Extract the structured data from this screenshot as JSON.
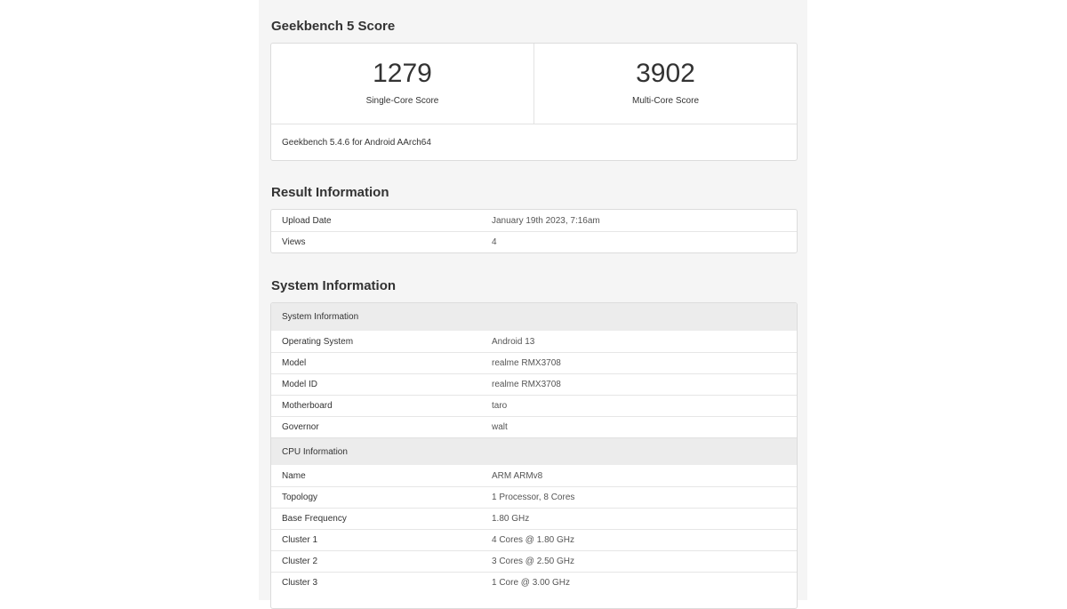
{
  "score": {
    "title": "Geekbench 5 Score",
    "single": {
      "value": "1279",
      "label": "Single-Core Score"
    },
    "multi": {
      "value": "3902",
      "label": "Multi-Core Score"
    },
    "version": "Geekbench 5.4.6 for Android AArch64"
  },
  "result": {
    "title": "Result Information",
    "rows": [
      {
        "key": "Upload Date",
        "value": "January 19th 2023, 7:16am"
      },
      {
        "key": "Views",
        "value": "4"
      }
    ]
  },
  "system": {
    "title": "System Information",
    "groups": [
      {
        "heading": "System Information",
        "rows": [
          {
            "key": "Operating System",
            "value": "Android 13"
          },
          {
            "key": "Model",
            "value": "realme RMX3708"
          },
          {
            "key": "Model ID",
            "value": "realme RMX3708"
          },
          {
            "key": "Motherboard",
            "value": "taro"
          },
          {
            "key": "Governor",
            "value": "walt"
          }
        ]
      },
      {
        "heading": "CPU Information",
        "rows": [
          {
            "key": "Name",
            "value": "ARM ARMv8"
          },
          {
            "key": "Topology",
            "value": "1 Processor, 8 Cores"
          },
          {
            "key": "Base Frequency",
            "value": "1.80 GHz"
          },
          {
            "key": "Cluster 1",
            "value": "4 Cores @ 1.80 GHz"
          },
          {
            "key": "Cluster 2",
            "value": "3 Cores @ 2.50 GHz"
          },
          {
            "key": "Cluster 3",
            "value": "1 Core @ 3.00 GHz"
          }
        ]
      }
    ]
  }
}
